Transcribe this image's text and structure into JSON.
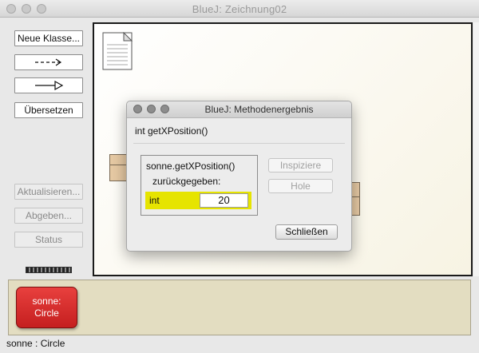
{
  "window": {
    "title": "BlueJ:  Zeichnung02"
  },
  "toolbar": {
    "new_class_label": "Neue Klasse...",
    "compile_label": "Übersetzen",
    "refresh_label": "Aktualisieren...",
    "submit_label": "Abgeben...",
    "status_label": "Status"
  },
  "object_bench": {
    "object_label_line1": "sonne:",
    "object_label_line2": "Circle"
  },
  "statusbar": {
    "text": "sonne : Circle"
  },
  "dialog": {
    "title": "BlueJ:  Methodenergebnis",
    "signature": "int getXPosition()",
    "expression": "sonne.getXPosition()",
    "returned_label": "zurückgegeben:",
    "result_type": "int",
    "result_value": "20",
    "inspect_label": "Inspiziere",
    "get_label": "Hole",
    "close_label": "Schließen"
  }
}
